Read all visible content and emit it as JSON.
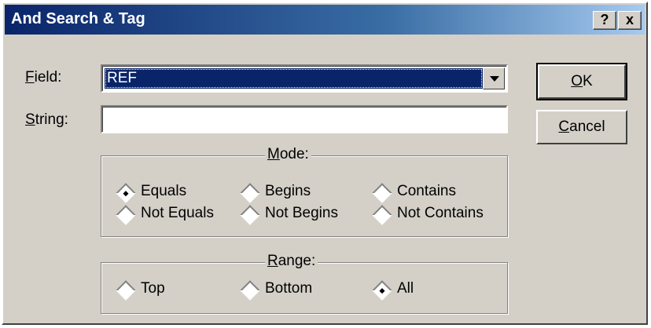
{
  "window": {
    "title": "And Search & Tag",
    "help_btn": "?",
    "close_btn": "x"
  },
  "form": {
    "field_label_ul": "F",
    "field_label_rest": "ield:",
    "field_value": "REF",
    "string_label_ul": "S",
    "string_label_rest": "tring:",
    "string_value": ""
  },
  "buttons": {
    "ok_ul": "O",
    "ok_rest": "K",
    "cancel_ul": "C",
    "cancel_rest": "ancel"
  },
  "mode": {
    "title_ul": "M",
    "title_rest": "ode:",
    "options": [
      {
        "label": "Equals",
        "checked": true
      },
      {
        "label": "Begins",
        "checked": false
      },
      {
        "label": "Contains",
        "checked": false
      },
      {
        "label": "Not Equals",
        "checked": false
      },
      {
        "label": "Not Begins",
        "checked": false
      },
      {
        "label": "Not Contains",
        "checked": false
      }
    ]
  },
  "range": {
    "title_ul": "R",
    "title_rest": "ange:",
    "options": [
      {
        "label": "Top",
        "checked": false
      },
      {
        "label": "Bottom",
        "checked": false
      },
      {
        "label": "All",
        "checked": true
      }
    ]
  }
}
